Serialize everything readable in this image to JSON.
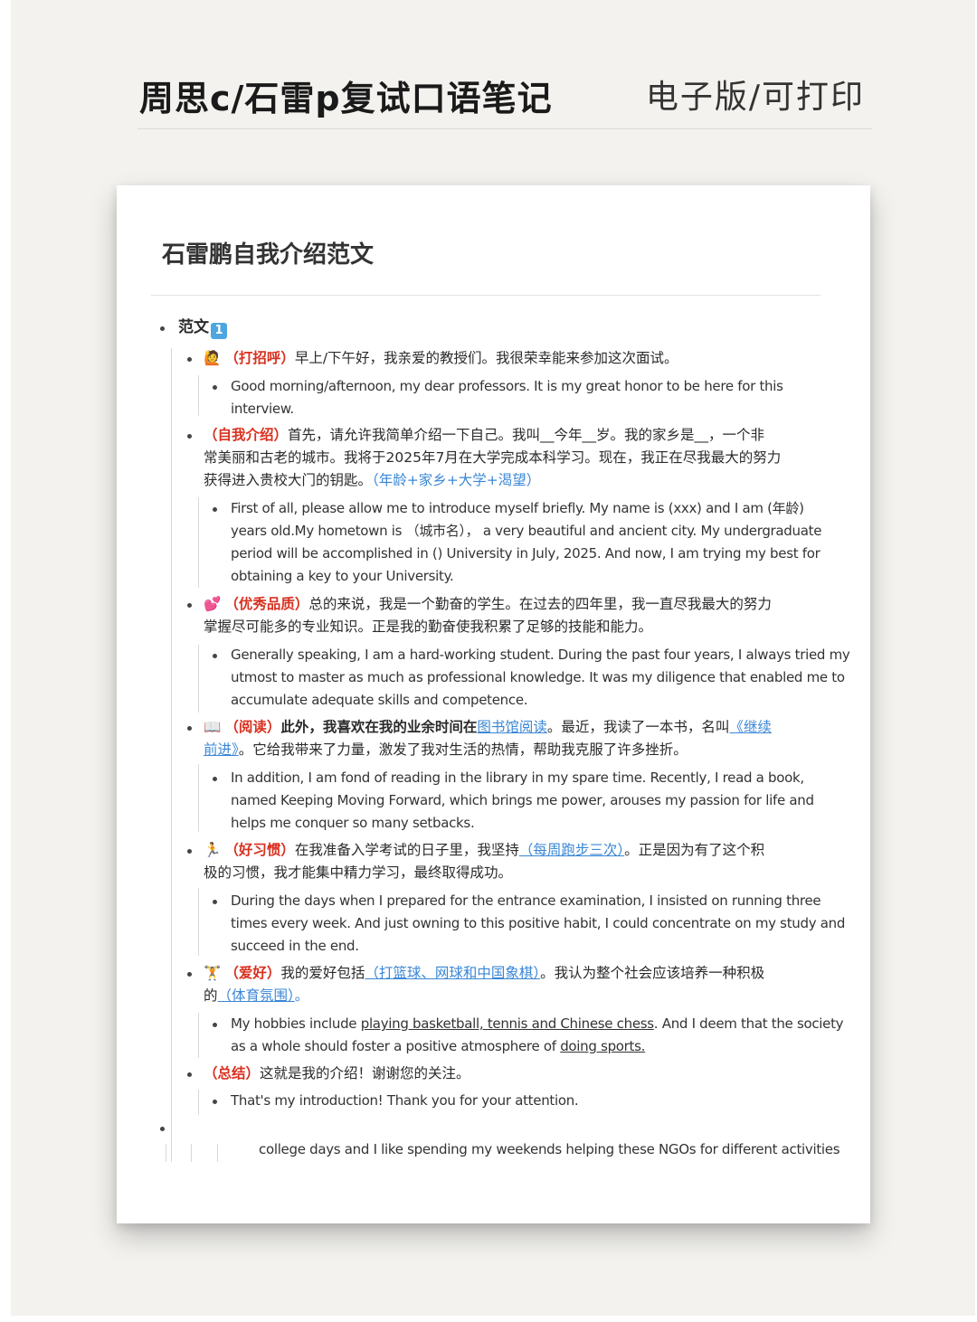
{
  "header": {
    "title": "周思c/石雷p复试口语笔记",
    "subtitle": "电子版/可打印"
  },
  "doc": {
    "title": "石雷鹏自我介绍范文",
    "section_label": "范文",
    "section_badge": "1",
    "greeting": {
      "icon": "🙋",
      "tag": "（打招呼）",
      "zh": "早上/下午好，我亲爱的教授们。我很荣幸能来参加这次面试。",
      "en1": "Good morning/afternoon, my dear professors. It is my great honor to be here for this",
      "en2": "interview."
    },
    "intro": {
      "tag": "（自我介绍）",
      "zh1": "首先，请允许我简单介绍一下自己。我叫__今年__岁。我的家乡是__，一个非",
      "zh2": "常美丽和古老的城市。我将于2025年7月在大学完成本科学习。现在，我正在尽我最大的努力",
      "zh3": "获得进入贵校大门的钥匙。",
      "hint": "（年龄+家乡+大学+渴望）",
      "en1": "First of all, please allow me to introduce myself briefly. My name is (xxx) and I am (年龄)",
      "en2": "years old.My hometown is （城市名）， a very beautiful and ancient city. My undergraduate",
      "en3": "period will be accomplished in () University in July, 2025. And now, I am trying my best for",
      "en4": "obtaining a key to your University."
    },
    "quality": {
      "icon": "💕",
      "tag": "（优秀品质）",
      "zh1": "总的来说，我是一个勤奋的学生。在过去的四年里，我一直尽我最大的努力",
      "zh2": "掌握尽可能多的专业知识。正是我的勤奋使我积累了足够的技能和能力。",
      "en1": "Generally speaking, I am a hard-working student. During the past four years, I always tried my",
      "en2": "utmost to master as much as professional knowledge. It was my diligence that enabled me to",
      "en3": "accumulate adequate skills and competence."
    },
    "reading": {
      "icon": "📖",
      "tag": "（阅读）",
      "zh1a": "此外，我喜欢在我的业余时间在",
      "zh1link": "图书馆阅读",
      "zh1b": "。最近，我读了一本书，名叫",
      "zh1c": "《继续",
      "zh2a": "前进》",
      "zh2b": "。它给我带来了力量，激发了我对生活的热情，帮助我克服了许多挫折。",
      "en1": "In addition, I am fond of reading in the library in my spare time. Recently, I read a book,",
      "en2": "named Keeping Moving Forward, which brings me power, arouses my passion for life and",
      "en3": "helps me conquer so many setbacks."
    },
    "habit": {
      "icon": "🏃",
      "tag": "（好习惯）",
      "zh1a": "在我准备入学考试的日子里，我坚持",
      "zh1link": "（每周跑步三次）",
      "zh1b": "。正是因为有了这个积",
      "zh2": "极的习惯，我才能集中精力学习，最终取得成功。",
      "en1": "During the days when I prepared for the entrance examination, I insisted on running three",
      "en2": "times every week. And just owning to this positive habit, I could concentrate on my study and",
      "en3": "succeed in the end."
    },
    "hobby": {
      "icon": "🏋",
      "tag": "（爱好）",
      "zh1a": "我的爱好包括",
      "zh1link": "（打篮球、网球和中国象棋）",
      "zh1b": "。我认为整个社会应该培养一种积极",
      "zh2a": "的",
      "zh2link": "（体育氛围）",
      "zh2b": "。",
      "en1a": "My hobbies include ",
      "en1u": "playing basketball, tennis and Chinese chess",
      "en1b": ". And I deem that the society",
      "en2a": "as a whole should foster a positive atmosphere of ",
      "en2u": "doing sports."
    },
    "summary": {
      "tag": "（总结）",
      "zh": "这就是我的介绍！谢谢您的关注。",
      "en": "That's my introduction! Thank you for your attention."
    },
    "trailing": "college days and I like spending my weekends helping these NGOs for different activities"
  }
}
